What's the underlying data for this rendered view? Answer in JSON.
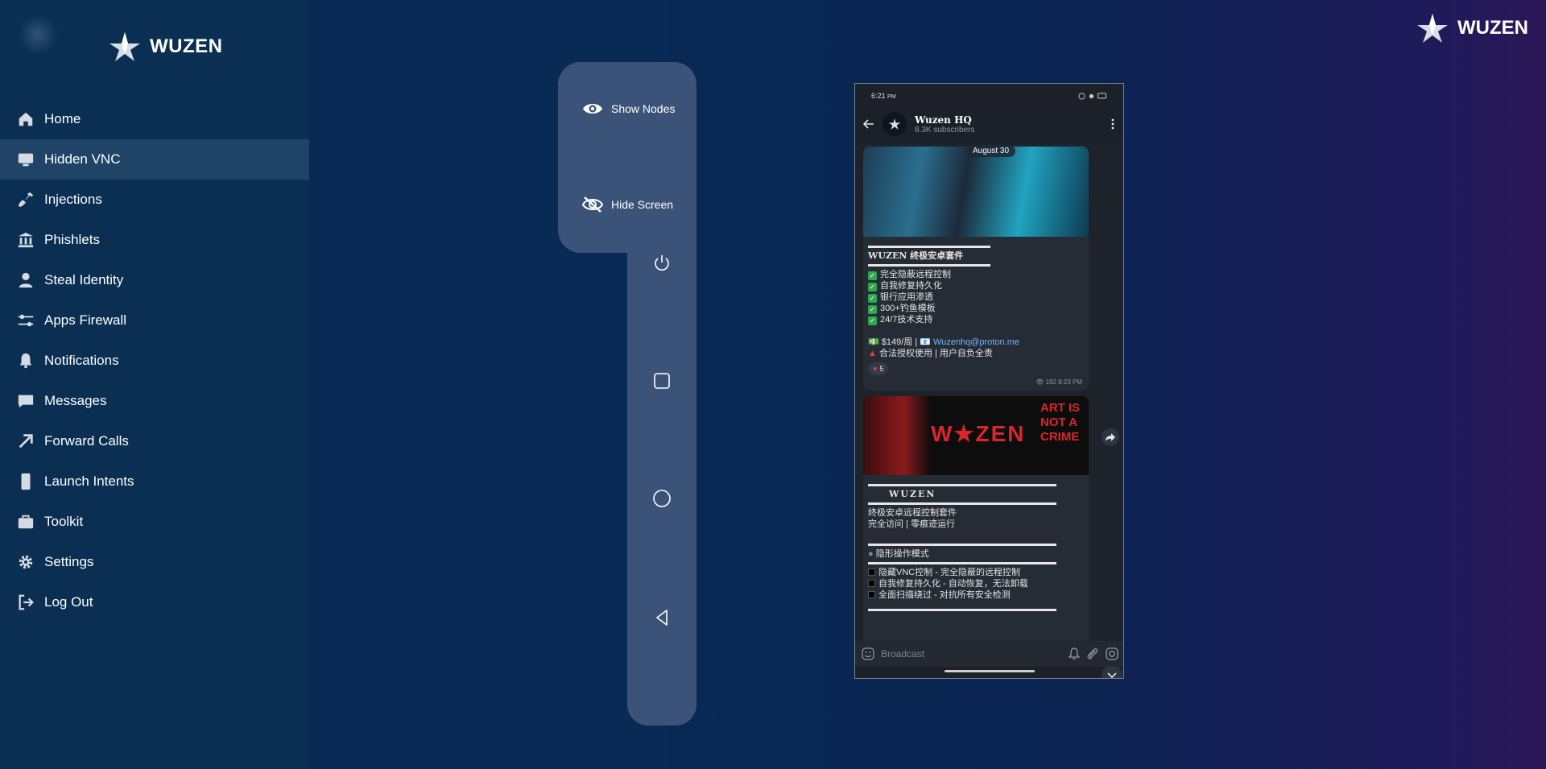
{
  "brand": {
    "name": "WUZEN"
  },
  "sidebar": {
    "items": [
      {
        "label": "Home",
        "icon": "home-icon"
      },
      {
        "label": "Hidden VNC",
        "icon": "monitor-icon",
        "active": true
      },
      {
        "label": "Injections",
        "icon": "syringe-icon"
      },
      {
        "label": "Phishlets",
        "icon": "bank-icon"
      },
      {
        "label": "Steal Identity",
        "icon": "user-icon"
      },
      {
        "label": "Apps Firewall",
        "icon": "sliders-icon"
      },
      {
        "label": "Notifications",
        "icon": "bell-icon"
      },
      {
        "label": "Messages",
        "icon": "message-icon"
      },
      {
        "label": "Forward Calls",
        "icon": "arrow-up-right-icon"
      },
      {
        "label": "Launch Intents",
        "icon": "phone-icon"
      },
      {
        "label": "Toolkit",
        "icon": "briefcase-icon"
      },
      {
        "label": "Settings",
        "icon": "gear-icon"
      },
      {
        "label": "Log Out",
        "icon": "logout-icon"
      }
    ]
  },
  "controls": {
    "show_nodes": "Show Nodes",
    "hide_screen": "Hide Screen"
  },
  "phone": {
    "status_time": "6:21",
    "status_ampm": "PM",
    "chat_title": "Wuzen HQ",
    "chat_subtitle": "8.3K subscribers",
    "date_label": "August 30",
    "msg1": {
      "title": "WUZEN 终极安卓套件",
      "features": [
        "完全隐蔽远程控制",
        "自我修复持久化",
        "银行应用渗透",
        "300+钓鱼模板",
        "24/7技术支持"
      ],
      "price": "$149/周 | ",
      "email": "Wuzenhq@proton.me",
      "disclaimer": "合法授权使用 | 用户自负全责",
      "reaction_count": "5",
      "views": "192",
      "time": "8:23 PM"
    },
    "msg2": {
      "img_text_left": "W★ZEN",
      "img_text_right": "ART IS NOT A CRIME",
      "title": "WUZEN",
      "line1": "终极安卓远程控制套件",
      "line2": "完全访问 | 零痕迹运行",
      "section": "隐形操作模式",
      "items": [
        "隐藏VNC控制 - 完全隐蔽的远程控制",
        "自我修复持久化 - 自动恢复，无法卸载",
        "全面扫描绕过 - 对抗所有安全检测"
      ]
    },
    "input_placeholder": "Broadcast"
  },
  "colors": {
    "sidebar_bg": "#0a2f52",
    "sidebar_active": "#1f4468",
    "panel_bg": "#3b5378",
    "link": "#6cb6ff"
  }
}
